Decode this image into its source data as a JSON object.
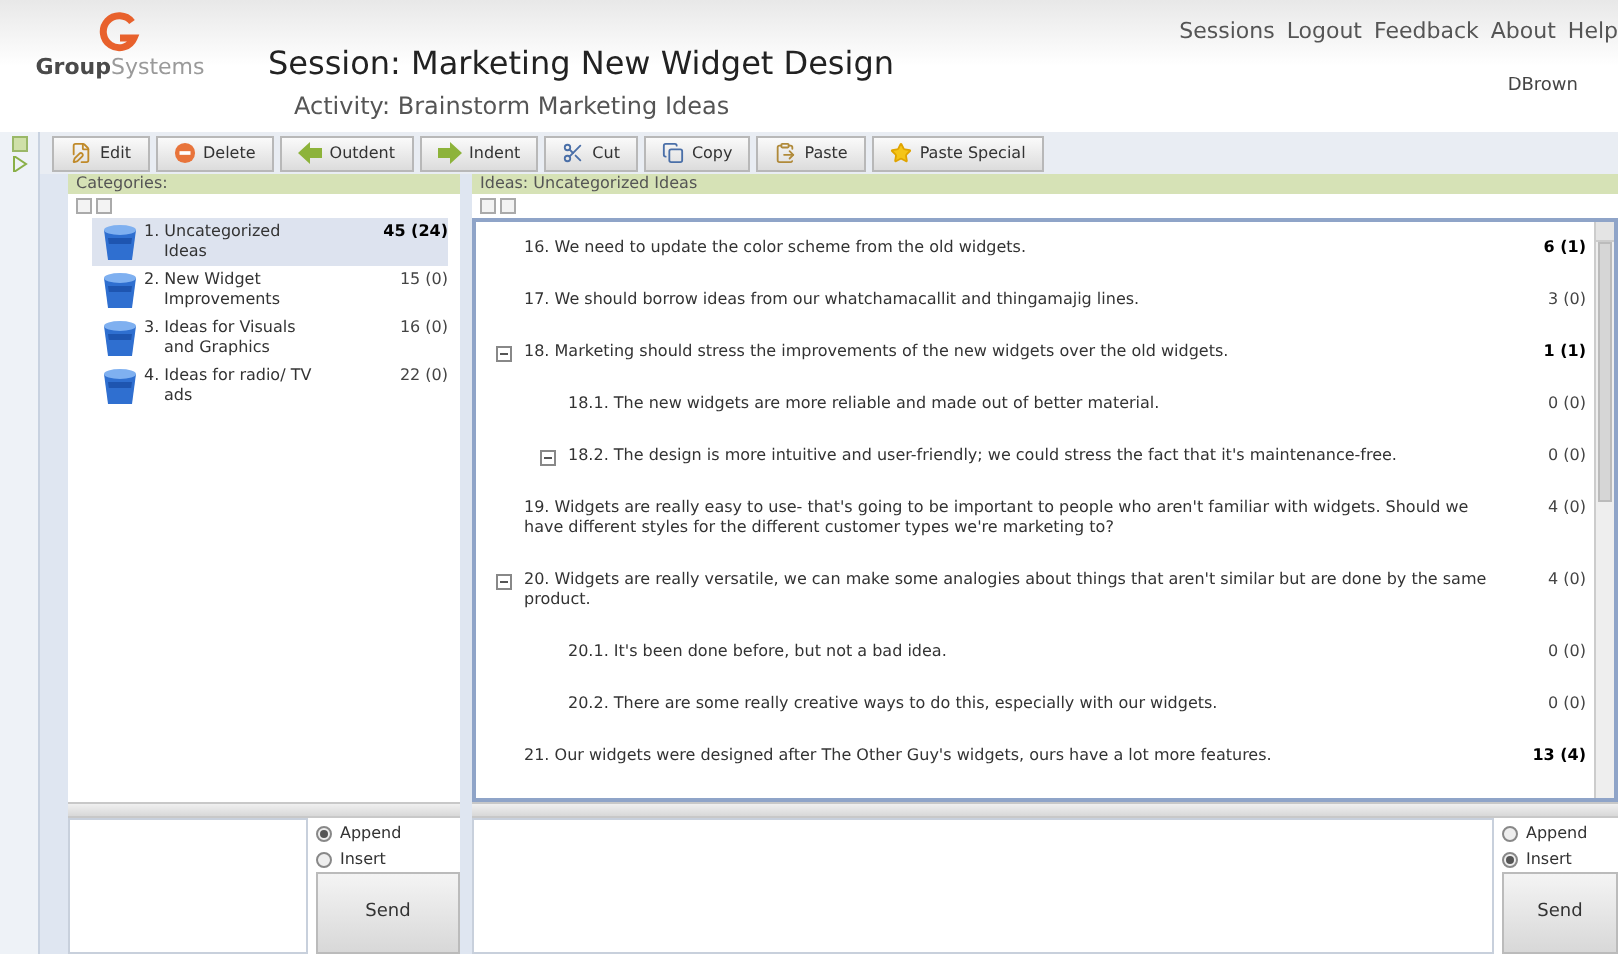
{
  "header": {
    "logo": "**Group**Systems",
    "session_title": "Session: Marketing New Widget Design",
    "activity": "Activity: Brainstorm Marketing Ideas",
    "nav": [
      "Sessions",
      "Logout",
      "Feedback",
      "About",
      "Help"
    ],
    "user": "DBrown"
  },
  "toolbar": [
    {
      "label": "Edit",
      "kind": "edit"
    },
    {
      "label": "Delete",
      "kind": "delete"
    },
    {
      "label": "Outdent",
      "kind": "outdent"
    },
    {
      "label": "Indent",
      "kind": "indent"
    },
    {
      "label": "Cut",
      "kind": "cut"
    },
    {
      "label": "Copy",
      "kind": "copy"
    },
    {
      "label": "Paste",
      "kind": "paste"
    },
    {
      "label": "Paste Special",
      "kind": "paste_special"
    }
  ],
  "categories": {
    "title": "Categories:",
    "items": [
      {
        "label": "1. Uncategorized Ideas",
        "count": "45 (24)",
        "selected": true,
        "bold": true
      },
      {
        "label": "2. New Widget Improvements",
        "count": "15 (0)",
        "selected": false,
        "bold": false
      },
      {
        "label": "3. Ideas for Visuals and Graphics",
        "count": "16 (0)",
        "selected": false,
        "bold": false
      },
      {
        "label": "4. Ideas for radio/ TV ads",
        "count": "22 (0)",
        "selected": false,
        "bold": false
      }
    ]
  },
  "ideas": {
    "title": "Ideas: Uncategorized Ideas",
    "items": [
      {
        "text": "16. We need to update the color scheme from the old widgets.",
        "count": "6 (1)",
        "bold": true,
        "toggle": false
      },
      {
        "text": "17. We should borrow ideas from our whatchamacallit and thingamajig lines.",
        "count": "3 (0)",
        "bold": false,
        "toggle": false
      },
      {
        "text": "18. Marketing should stress the improvements of the new widgets over the old widgets.",
        "count": "1 (1)",
        "bold": true,
        "toggle": true,
        "children": [
          {
            "text": "18.1. The new widgets are more reliable and made out of better material.",
            "count": "0 (0)",
            "bold": false,
            "toggle": false
          },
          {
            "text": "18.2. The design is more intuitive and user-friendly; we could stress the fact that it's maintenance-free.",
            "count": "0 (0)",
            "bold": false,
            "toggle": true
          }
        ]
      },
      {
        "text": "19. Widgets are really easy to use- that's going to be important to people who aren't familiar with widgets. Should we have different styles for the different customer types we're marketing to?",
        "count": "4 (0)",
        "bold": false,
        "toggle": false
      },
      {
        "text": "20. Widgets are really versatile, we can make some analogies about things that aren't similar but are done by the same product.",
        "count": "4 (0)",
        "bold": false,
        "toggle": true,
        "children": [
          {
            "text": "20.1. It's been done before, but not a bad idea.",
            "count": "0 (0)",
            "bold": false,
            "toggle": false
          },
          {
            "text": "20.2. There are some really creative ways to do this, especially with our widgets.",
            "count": "0 (0)",
            "bold": false,
            "toggle": false
          }
        ]
      },
      {
        "text": "21. Our widgets were designed after The Other Guy's widgets, ours have a lot more features.",
        "count": "13 (4)",
        "bold": true,
        "toggle": false
      }
    ]
  },
  "composers": [
    {
      "options": [
        {
          "label": "Append",
          "selected": true
        },
        {
          "label": "Insert",
          "selected": false
        }
      ],
      "send": "Send"
    },
    {
      "options": [
        {
          "label": "Append",
          "selected": false
        },
        {
          "label": "Insert",
          "selected": true
        }
      ],
      "send": "Send"
    }
  ]
}
